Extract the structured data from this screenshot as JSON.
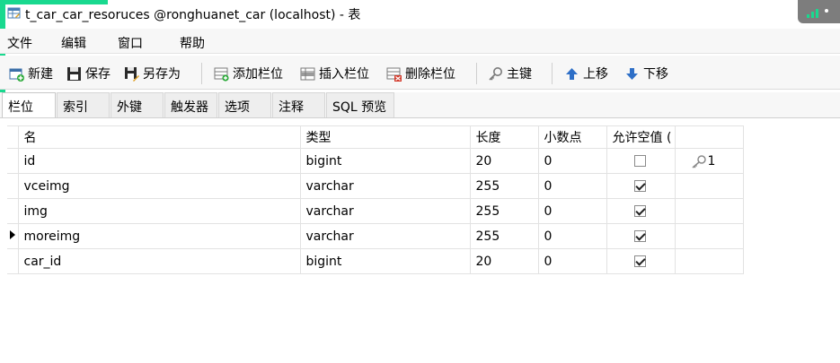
{
  "window": {
    "title": "t_car_car_resoruces @ronghuanet_car (localhost) - 表"
  },
  "menu": {
    "items": [
      "文件",
      "编辑",
      "窗口",
      "帮助"
    ]
  },
  "toolbar": {
    "new_label": "新建",
    "save_label": "保存",
    "save_as_label": "另存为",
    "add_field_label": "添加栏位",
    "insert_field_label": "插入栏位",
    "delete_field_label": "删除栏位",
    "primary_key_label": "主键",
    "move_up_label": "上移",
    "move_down_label": "下移"
  },
  "tabs": [
    "栏位",
    "索引",
    "外键",
    "触发器",
    "选项",
    "注释",
    "SQL 预览"
  ],
  "active_tab": "栏位",
  "fields": {
    "headers": [
      "名",
      "类型",
      "长度",
      "小数点",
      "允许空值 (",
      ""
    ],
    "rows": [
      {
        "name": "id",
        "type": "bigint",
        "length": "20",
        "decimals": "0",
        "allow_null": false,
        "key": "1",
        "current": false
      },
      {
        "name": "vceimg",
        "type": "varchar",
        "length": "255",
        "decimals": "0",
        "allow_null": true,
        "key": "",
        "current": false
      },
      {
        "name": "img",
        "type": "varchar",
        "length": "255",
        "decimals": "0",
        "allow_null": true,
        "key": "",
        "current": false
      },
      {
        "name": "moreimg",
        "type": "varchar",
        "length": "255",
        "decimals": "0",
        "allow_null": true,
        "key": "",
        "current": true
      },
      {
        "name": "car_id",
        "type": "bigint",
        "length": "20",
        "decimals": "0",
        "allow_null": true,
        "key": "",
        "current": false
      }
    ]
  },
  "colors": {
    "accent_green": "#19d98f",
    "toolbar_bg": "#f7f7f7",
    "grid_line": "#e2e2e2"
  }
}
